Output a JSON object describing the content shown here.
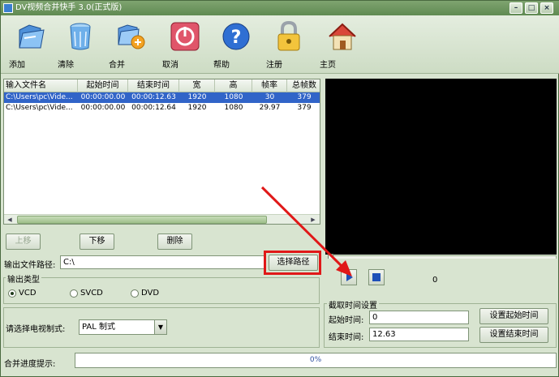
{
  "window": {
    "title": "DV视频合并快手 3.0(正式版)"
  },
  "toolbar": {
    "add": "添加",
    "clear": "清除",
    "merge": "合并",
    "cancel": "取消",
    "help": "帮助",
    "register": "注册",
    "home": "主页"
  },
  "table": {
    "headers": [
      "输入文件名",
      "起始时间",
      "结束时间",
      "宽",
      "高",
      "帧率",
      "总帧数"
    ],
    "rows": [
      [
        "C:\\Users\\pc\\Vide...",
        "00:00:00.00",
        "00:00:12.63",
        "1920",
        "1080",
        "30",
        "379"
      ],
      [
        "C:\\Users\\pc\\Vide...",
        "00:00:00.00",
        "00:00:12.64",
        "1920",
        "1080",
        "29.97",
        "379"
      ]
    ],
    "selected_row": 0
  },
  "list_buttons": {
    "up": "上移",
    "down": "下移",
    "delete": "删除"
  },
  "output": {
    "path_label": "输出文件路径:",
    "path_value": "C:\\",
    "browse_button": "选择路径"
  },
  "output_type": {
    "group_label": "输出类型",
    "options": [
      "VCD",
      "SVCD",
      "DVD"
    ],
    "selected": "VCD"
  },
  "tv_standard": {
    "label": "请选择电视制式:",
    "value": "PAL 制式"
  },
  "player": {
    "frame_number": "0"
  },
  "clip_time": {
    "group_label": "截取时间设置",
    "start_label": "起始时间:",
    "start_value": "0",
    "end_label": "结束时间:",
    "end_value": "12.63",
    "set_start_button": "设置起始时间",
    "set_end_button": "设置结束时间"
  },
  "progress": {
    "label": "合并进度提示:",
    "text": "0%",
    "value": 0
  },
  "colors": {
    "highlight": "#e01818",
    "selection": "#3164c8",
    "accent_green": "#5f8a52"
  }
}
